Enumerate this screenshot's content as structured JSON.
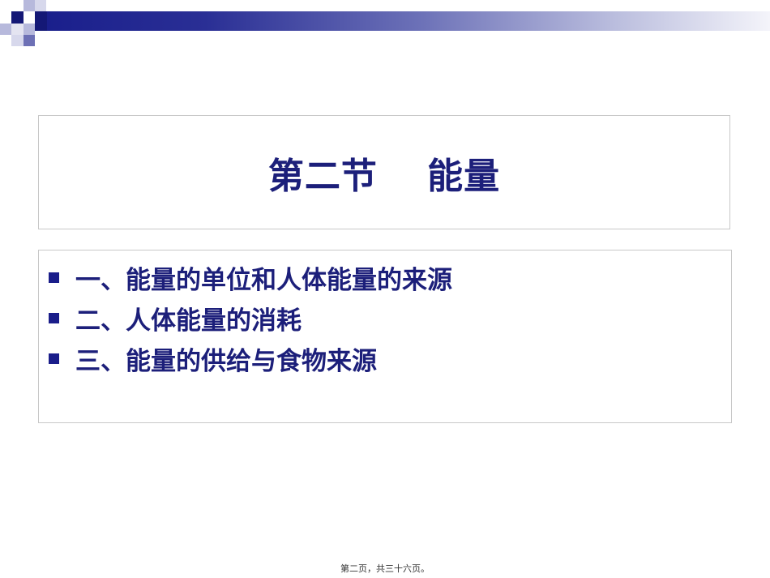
{
  "slide": {
    "title": "第二节　 能量",
    "bullets": [
      {
        "text": "一、能量的单位和人体能量的来源"
      },
      {
        "text": "二、人体能量的消耗"
      },
      {
        "text": "三、能量的供给与食物来源"
      }
    ],
    "footer": "第二页，共三十六页。"
  },
  "colors": {
    "title": "#1c1f7a",
    "bullet": "#1a1d8a",
    "accent_bar": "#1a1f8c",
    "deco_light": "#b7b9dc",
    "deco_dark": "#141876",
    "deco_mid": "#6d70b5",
    "border": "#c8c8c8"
  },
  "icons": {
    "bullet": "square-bullet-icon"
  }
}
